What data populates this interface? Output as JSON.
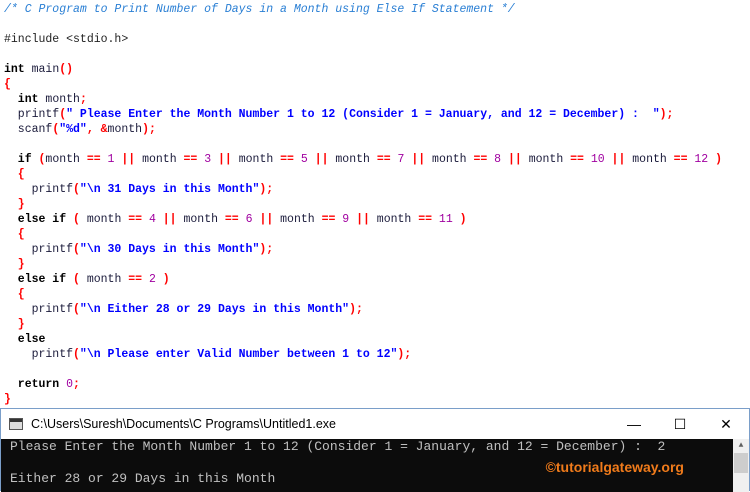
{
  "code_lines": [
    [
      [
        "c",
        "/* C Program to Print Number of Days in a Month using Else If Statement */"
      ]
    ],
    [],
    [
      [
        "p",
        "#include <stdio.h>"
      ]
    ],
    [],
    [
      [
        "k",
        "int"
      ],
      [
        "i",
        " main"
      ],
      [
        "o",
        "()"
      ]
    ],
    [
      [
        "o",
        "{"
      ]
    ],
    [
      [
        "k",
        "  int"
      ],
      [
        "i",
        " month"
      ],
      [
        "o",
        ";"
      ]
    ],
    [
      [
        "i",
        "  printf"
      ],
      [
        "o",
        "("
      ],
      [
        "s",
        "\" Please Enter the Month Number 1 to 12 (Consider 1 = January, and 12 = December) :  \""
      ],
      [
        "o",
        ");"
      ]
    ],
    [
      [
        "i",
        "  scanf"
      ],
      [
        "o",
        "("
      ],
      [
        "s",
        "\"%d\""
      ],
      [
        "o",
        ", &"
      ],
      [
        "i",
        "month"
      ],
      [
        "o",
        ");"
      ]
    ],
    [],
    [
      [
        "k",
        "  if"
      ],
      [
        "o",
        " ("
      ],
      [
        "i",
        "month "
      ],
      [
        "o",
        "=="
      ],
      [
        "n",
        " 1 "
      ],
      [
        "o",
        "||"
      ],
      [
        "i",
        " month "
      ],
      [
        "o",
        "=="
      ],
      [
        "n",
        " 3 "
      ],
      [
        "o",
        "||"
      ],
      [
        "i",
        " month "
      ],
      [
        "o",
        "=="
      ],
      [
        "n",
        " 5 "
      ],
      [
        "o",
        "||"
      ],
      [
        "i",
        " month "
      ],
      [
        "o",
        "=="
      ],
      [
        "n",
        " 7 "
      ],
      [
        "o",
        "||"
      ],
      [
        "i",
        " month "
      ],
      [
        "o",
        "=="
      ],
      [
        "n",
        " 8 "
      ],
      [
        "o",
        "||"
      ],
      [
        "i",
        " month "
      ],
      [
        "o",
        "=="
      ],
      [
        "n",
        " 10 "
      ],
      [
        "o",
        "||"
      ],
      [
        "i",
        " month "
      ],
      [
        "o",
        "=="
      ],
      [
        "n",
        " 12 "
      ],
      [
        "o",
        ")"
      ]
    ],
    [
      [
        "o",
        "  {"
      ]
    ],
    [
      [
        "i",
        "    printf"
      ],
      [
        "o",
        "("
      ],
      [
        "s",
        "\"\\n 31 Days in this Month\""
      ],
      [
        "o",
        ");"
      ]
    ],
    [
      [
        "o",
        "  }"
      ]
    ],
    [
      [
        "k",
        "  else if"
      ],
      [
        "o",
        " ("
      ],
      [
        "i",
        " month "
      ],
      [
        "o",
        "=="
      ],
      [
        "n",
        " 4 "
      ],
      [
        "o",
        "||"
      ],
      [
        "i",
        " month "
      ],
      [
        "o",
        "=="
      ],
      [
        "n",
        " 6 "
      ],
      [
        "o",
        "||"
      ],
      [
        "i",
        " month "
      ],
      [
        "o",
        "=="
      ],
      [
        "n",
        " 9 "
      ],
      [
        "o",
        "||"
      ],
      [
        "i",
        " month "
      ],
      [
        "o",
        "=="
      ],
      [
        "n",
        " 11 "
      ],
      [
        "o",
        ")"
      ]
    ],
    [
      [
        "o",
        "  {"
      ]
    ],
    [
      [
        "i",
        "    printf"
      ],
      [
        "o",
        "("
      ],
      [
        "s",
        "\"\\n 30 Days in this Month\""
      ],
      [
        "o",
        ");"
      ]
    ],
    [
      [
        "o",
        "  }"
      ]
    ],
    [
      [
        "k",
        "  else if"
      ],
      [
        "o",
        " ("
      ],
      [
        "i",
        " month "
      ],
      [
        "o",
        "=="
      ],
      [
        "n",
        " 2 "
      ],
      [
        "o",
        ")"
      ]
    ],
    [
      [
        "o",
        "  {"
      ]
    ],
    [
      [
        "i",
        "    printf"
      ],
      [
        "o",
        "("
      ],
      [
        "s",
        "\"\\n Either 28 or 29 Days in this Month\""
      ],
      [
        "o",
        ");"
      ]
    ],
    [
      [
        "o",
        "  }"
      ]
    ],
    [
      [
        "k",
        "  else"
      ]
    ],
    [
      [
        "i",
        "    printf"
      ],
      [
        "o",
        "("
      ],
      [
        "s",
        "\"\\n Please enter Valid Number between 1 to 12\""
      ],
      [
        "o",
        ");"
      ]
    ],
    [],
    [
      [
        "k",
        "  return"
      ],
      [
        "n",
        " 0"
      ],
      [
        "o",
        ";"
      ]
    ],
    [
      [
        "o",
        "}"
      ]
    ]
  ],
  "console": {
    "title": "C:\\Users\\Suresh\\Documents\\C Programs\\Untitled1.exe",
    "minimize": "—",
    "maximize": "☐",
    "close": "✕",
    "output": [
      "Please Enter the Month Number 1 to 12 (Consider 1 = January, and 12 = December) :  2",
      "",
      "Either 28 or 29 Days in this Month"
    ],
    "watermark": "©tutorialgateway.org",
    "scroll_up": "▲"
  }
}
